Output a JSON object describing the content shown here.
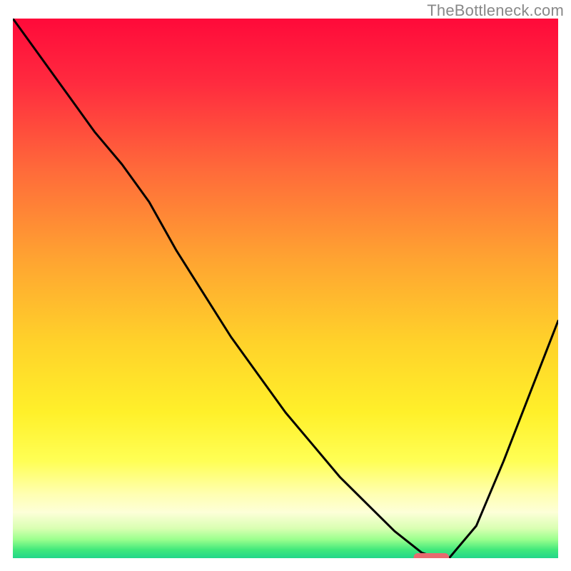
{
  "watermark": "TheBottleneck.com",
  "colors": {
    "curve": "#000000",
    "marker": "#e86a6f",
    "gradient_stops": [
      {
        "offset": 0.0,
        "color": "#ff0a3a"
      },
      {
        "offset": 0.12,
        "color": "#ff2b3f"
      },
      {
        "offset": 0.28,
        "color": "#ff6a3a"
      },
      {
        "offset": 0.45,
        "color": "#ffa531"
      },
      {
        "offset": 0.6,
        "color": "#ffd22a"
      },
      {
        "offset": 0.73,
        "color": "#fff02a"
      },
      {
        "offset": 0.82,
        "color": "#ffff55"
      },
      {
        "offset": 0.88,
        "color": "#ffffb0"
      },
      {
        "offset": 0.915,
        "color": "#fdffd8"
      },
      {
        "offset": 0.945,
        "color": "#d9ffb2"
      },
      {
        "offset": 0.965,
        "color": "#9cff8e"
      },
      {
        "offset": 0.985,
        "color": "#3fe87b"
      },
      {
        "offset": 1.0,
        "color": "#22d68a"
      }
    ]
  },
  "chart_data": {
    "type": "line",
    "x": [
      0.0,
      0.05,
      0.1,
      0.15,
      0.2,
      0.25,
      0.3,
      0.35,
      0.4,
      0.45,
      0.5,
      0.55,
      0.6,
      0.65,
      0.7,
      0.75,
      0.78,
      0.8,
      0.85,
      0.9,
      0.95,
      1.0
    ],
    "values": [
      100,
      93,
      86,
      79,
      73,
      66,
      57,
      49,
      41,
      34,
      27,
      21,
      15,
      10,
      5,
      1,
      0,
      0,
      6,
      18,
      31,
      44
    ],
    "xlabel": "",
    "ylabel": "",
    "title": "",
    "xlim": [
      0,
      1
    ],
    "ylim": [
      0,
      100
    ],
    "marker": {
      "x0": 0.735,
      "x1": 0.8,
      "y": 0
    }
  }
}
